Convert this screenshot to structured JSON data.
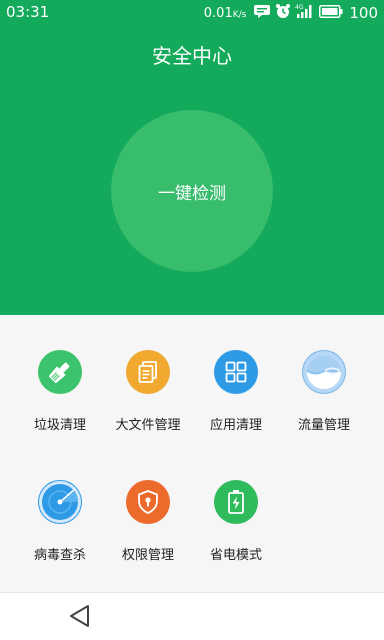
{
  "status_bar": {
    "time": "03:31",
    "net_speed": "0.01",
    "net_unit": "K/s",
    "battery": "100",
    "icons": [
      "message-icon",
      "alarm-icon",
      "signal-4g-icon",
      "battery-icon"
    ]
  },
  "header": {
    "title": "安全中心",
    "scan_button": "一键检测",
    "bg_color": "#14aa5c"
  },
  "tools": [
    {
      "label": "垃圾清理",
      "icon": "broom-icon",
      "color": "#3cc46c"
    },
    {
      "label": "大文件管理",
      "icon": "documents-icon",
      "color": "#f0a92e"
    },
    {
      "label": "应用清理",
      "icon": "apps-grid-icon",
      "color": "#2e9ae6"
    },
    {
      "label": "流量管理",
      "icon": "data-usage-icon",
      "color": "#7ab8ea"
    },
    {
      "label": "病毒查杀",
      "icon": "radar-icon",
      "color": "#2e9ae6"
    },
    {
      "label": "权限管理",
      "icon": "shield-icon",
      "color": "#ec6a2c"
    },
    {
      "label": "省电模式",
      "icon": "battery-saver-icon",
      "color": "#2fbb5c"
    }
  ],
  "nav": {
    "back_icon": "back-triangle-icon"
  }
}
